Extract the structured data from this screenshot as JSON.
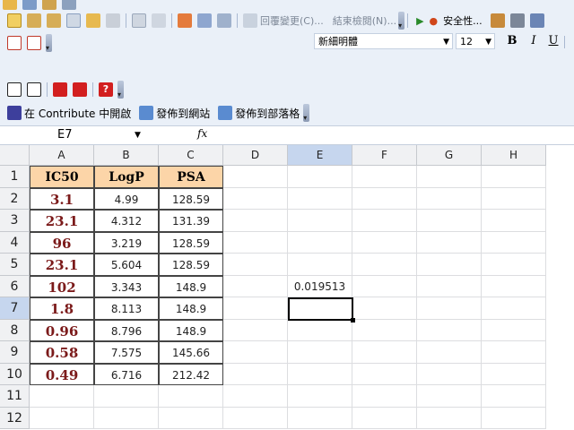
{
  "toolbar1": {
    "track_changes_label": "回覆變更(C)...",
    "end_review_label": "結束檢閱(N)...",
    "security_label": "安全性..."
  },
  "format": {
    "font_name": "新細明體",
    "font_size": "12",
    "bold": "B",
    "italic": "I",
    "underline": "U"
  },
  "contribute": {
    "open_label": "在 Contribute 中開啟",
    "publish_site_label": "發佈到網站",
    "publish_blog_label": "發佈到部落格"
  },
  "formula_bar": {
    "cell_ref": "E7",
    "fx": "fx"
  },
  "columns": [
    "A",
    "B",
    "C",
    "D",
    "E",
    "F",
    "G",
    "H"
  ],
  "rows": [
    "1",
    "2",
    "3",
    "4",
    "5",
    "6",
    "7",
    "8",
    "9",
    "10",
    "11",
    "12"
  ],
  "table": {
    "headers": [
      "IC50",
      "LogP",
      "PSA"
    ],
    "rows": [
      [
        "3.1",
        "4.99",
        "128.59"
      ],
      [
        "23.1",
        "4.312",
        "131.39"
      ],
      [
        "96",
        "3.219",
        "128.59"
      ],
      [
        "23.1",
        "5.604",
        "128.59"
      ],
      [
        "102",
        "3.343",
        "148.9"
      ],
      [
        "1.8",
        "8.113",
        "148.9"
      ],
      [
        "0.96",
        "8.796",
        "148.9"
      ],
      [
        "0.58",
        "7.575",
        "145.66"
      ],
      [
        "0.49",
        "6.716",
        "212.42"
      ]
    ]
  },
  "e6_value": "0.019513",
  "colors": {
    "header_fill": "#fcd5a8",
    "ic50_text": "#7b1a1a",
    "selection": "#c6d6ee"
  }
}
